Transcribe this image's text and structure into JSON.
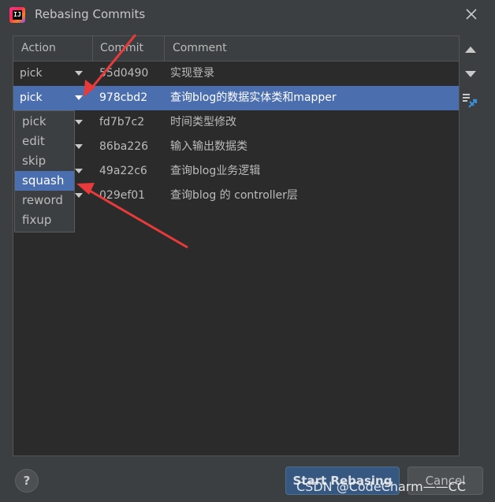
{
  "window": {
    "title": "Rebasing Commits",
    "icon": "intellij-idea-icon"
  },
  "table": {
    "headers": {
      "action": "Action",
      "commit": "Commit",
      "comment": "Comment"
    },
    "rows": [
      {
        "action": "pick",
        "commit": "55d0490",
        "comment": "实现登录"
      },
      {
        "action": "pick",
        "commit": "978cbd2",
        "comment": "查询blog的数据实体类和mapper",
        "selected": true
      },
      {
        "action": "",
        "commit": "fd7b7c2",
        "comment": "时间类型修改"
      },
      {
        "action": "",
        "commit": "86ba226",
        "comment": "输入输出数据类"
      },
      {
        "action": "",
        "commit": "49a22c6",
        "comment": "查询blog业务逻辑"
      },
      {
        "action": "",
        "commit": "029ef01",
        "comment": "查询blog 的 controller层"
      }
    ]
  },
  "dropdown": {
    "options": [
      "pick",
      "edit",
      "skip",
      "squash",
      "reword",
      "fixup"
    ],
    "highlighted": "squash"
  },
  "side_buttons": [
    "move-up-icon",
    "move-down-icon",
    "unite-commits-icon"
  ],
  "footer": {
    "help_label": "?",
    "start_label": "Start Rebasing",
    "cancel_label": "Cancel"
  },
  "watermark": "CSDN @CodeCharm——CC",
  "colors": {
    "background": "#3c3f41",
    "table_background": "#2b2b2b",
    "selection": "#4b6eaf",
    "annotation_arrow": "#e83a3a",
    "primary_button": "#365880"
  }
}
